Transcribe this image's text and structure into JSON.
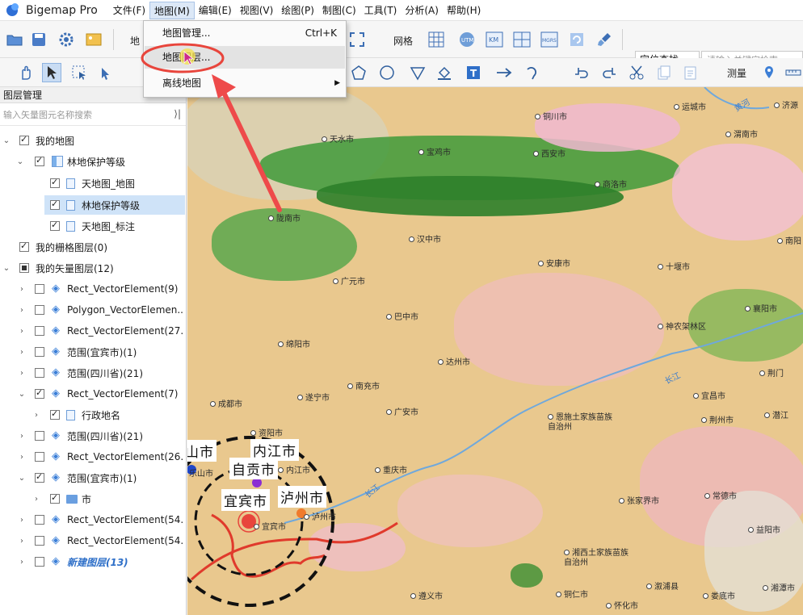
{
  "app": {
    "title": "Bigemap Pro"
  },
  "menu": [
    "文件(F)",
    "地图(M)",
    "编辑(E)",
    "视图(V)",
    "绘图(P)",
    "制图(C)",
    "工具(T)",
    "分析(A)",
    "帮助(H)"
  ],
  "dropdown": {
    "items": [
      {
        "label": "地图管理...",
        "shortcut": "Ctrl+K"
      },
      {
        "label": "地图图层..."
      },
      {
        "label": "离线地图"
      }
    ]
  },
  "toolbar": {
    "map_label": "地",
    "grid_label": "网格",
    "locate_select": "定位查找",
    "search_placeholder": "请输入关键字检索",
    "measure_label": "测量"
  },
  "layer_panel": {
    "title": "图层管理",
    "search_placeholder": "输入矢量图元名称搜索",
    "collapse_glyph": "⟩|",
    "rows": [
      {
        "label": "我的地图"
      },
      {
        "label": "林地保护等级"
      },
      {
        "label": "天地图_地图"
      },
      {
        "label": "林地保护等级"
      },
      {
        "label": "天地图_标注"
      },
      {
        "label": "我的栅格图层(0)"
      },
      {
        "label": "我的矢量图层(12)"
      },
      {
        "label": "Rect_VectorElement(9)"
      },
      {
        "label": "Polygon_VectorElemen..."
      },
      {
        "label": "Rect_VectorElement(27..."
      },
      {
        "label": "范围(宜宾市)(1)"
      },
      {
        "label": "范围(四川省)(21)"
      },
      {
        "label": "Rect_VectorElement(7)"
      },
      {
        "label": "行政地名"
      },
      {
        "label": "范围(四川省)(21)"
      },
      {
        "label": "Rect_VectorElement(26..."
      },
      {
        "label": "范围(宜宾市)(1)"
      },
      {
        "label": "市"
      },
      {
        "label": "Rect_VectorElement(54..."
      },
      {
        "label": "Rect_VectorElement(54..."
      },
      {
        "label": "新建图层(13)"
      }
    ]
  },
  "map": {
    "cities": [
      "天水市",
      "宝鸡市",
      "西安市",
      "铜川市",
      "运城市",
      "济源",
      "渭南市",
      "商洛市",
      "陇南市",
      "汉中市",
      "安康市",
      "十堰市",
      "南阳",
      "广元市",
      "巴中市",
      "襄阳市",
      "神农架林区",
      "绵阳市",
      "达州市",
      "荆门",
      "南充市",
      "遂宁市",
      "宜昌市",
      "荆州市",
      "潜江",
      "成都市",
      "资阳市",
      "广安市",
      "恩施土家族苗族自治州",
      "重庆市",
      "张家界市",
      "常德市",
      "益阳市",
      "乐山市",
      "内江市",
      "泸州市",
      "宜宾市",
      "湘西土家族苗族自治州",
      "遵义市",
      "铜仁市",
      "怀化市",
      "娄底市",
      "湘潭市",
      "溆浦县"
    ],
    "big_labels": [
      "山市",
      "内江市",
      "自贡市",
      "宜宾市",
      "泸州市"
    ],
    "rivers": [
      "黄河",
      "长江",
      "长江"
    ]
  },
  "colors": {
    "accent": "#3c6db0",
    "selection": "#cfe3f8",
    "annotation": "#e8453c"
  }
}
